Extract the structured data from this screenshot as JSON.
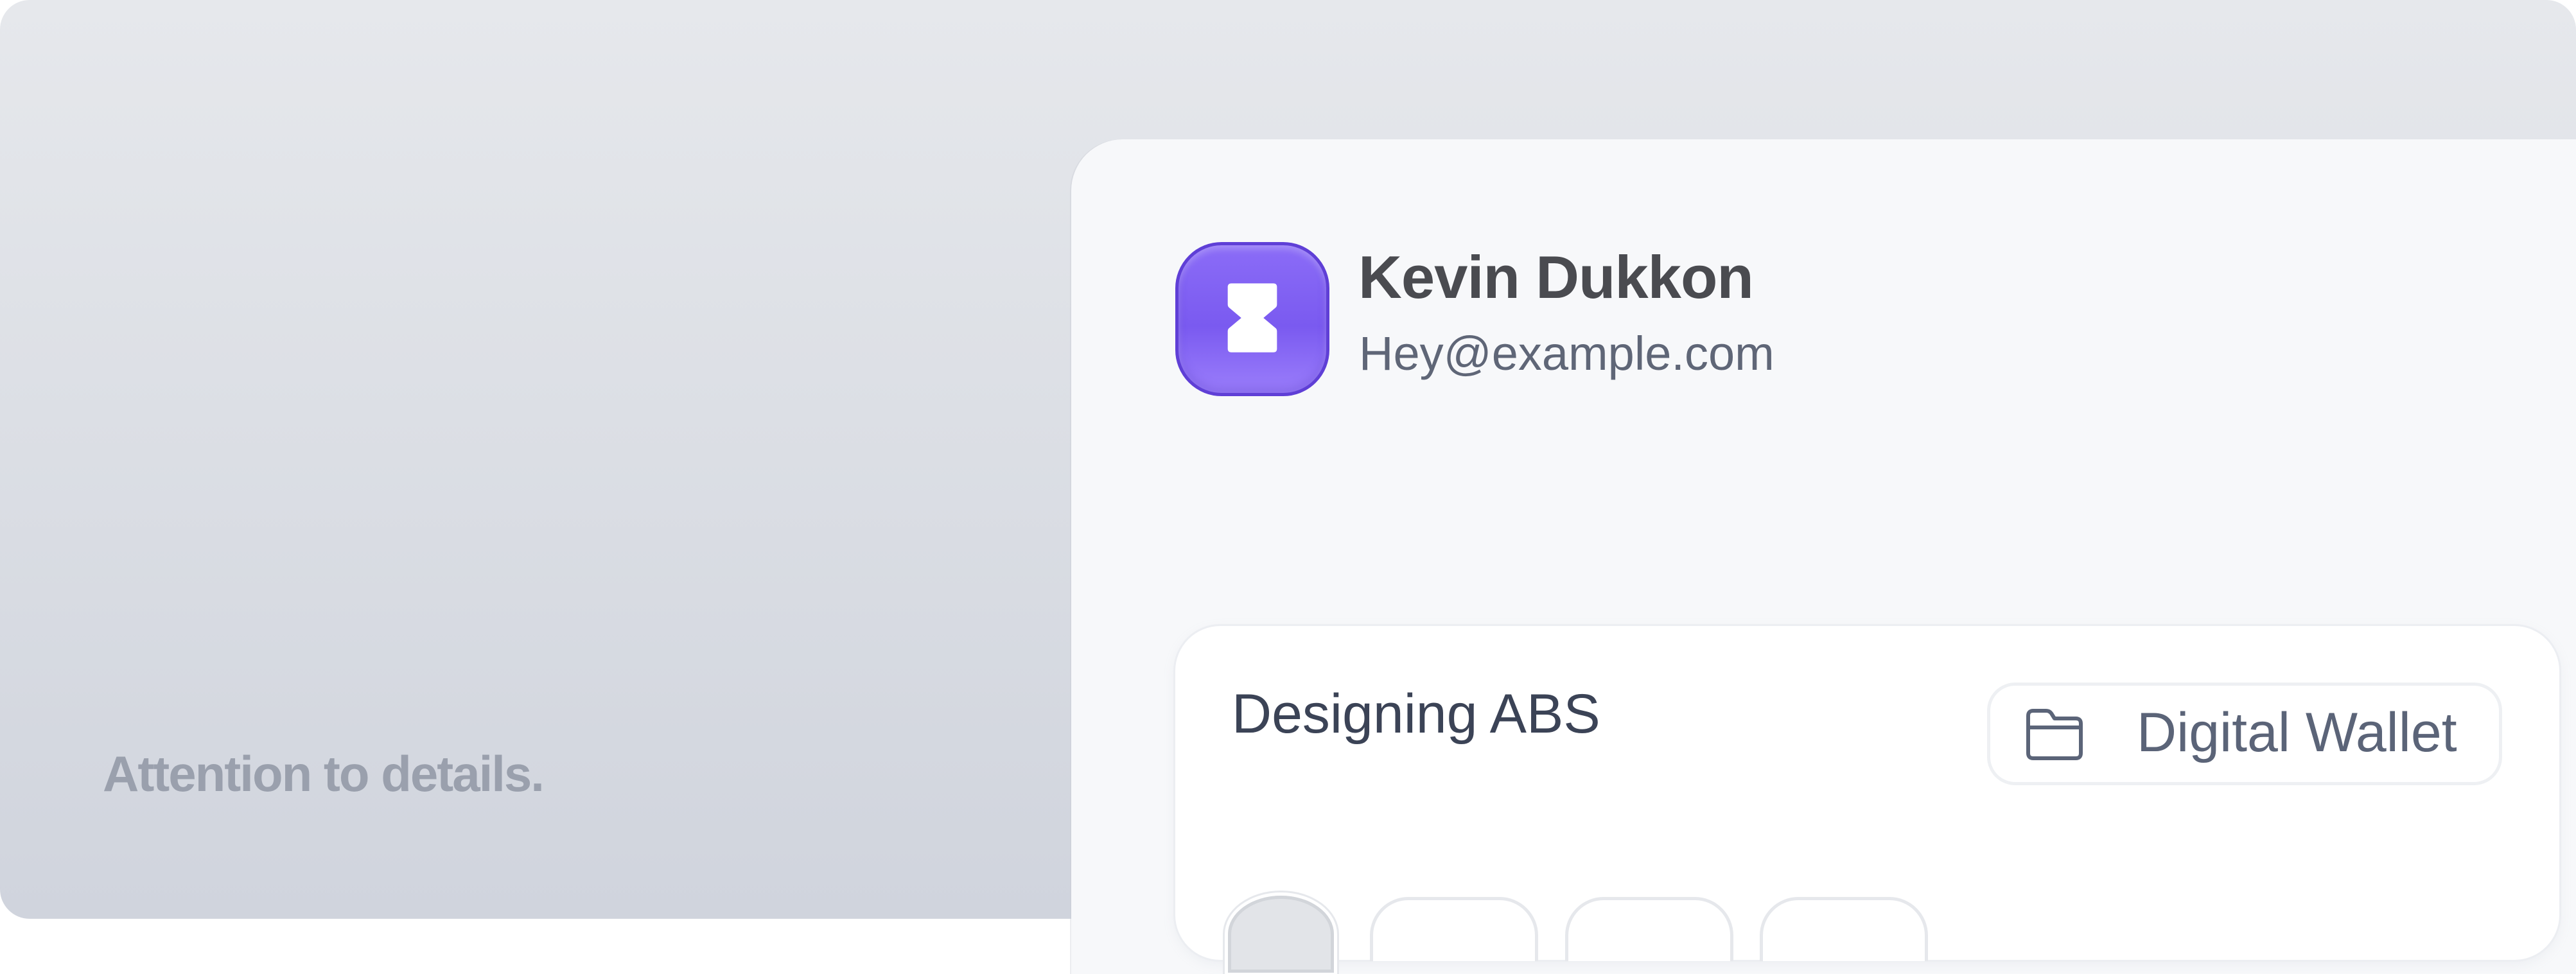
{
  "caption": "Attention to details.",
  "profile": {
    "name": "Kevin Dukkon",
    "email": "Hey@example.com",
    "icon": "hourglass-icon",
    "accent_color": "#7c5cf4"
  },
  "card": {
    "title": "Designing ABS",
    "wallet_chip": {
      "icon": "folder-icon",
      "label": "Digital Wallet"
    }
  }
}
